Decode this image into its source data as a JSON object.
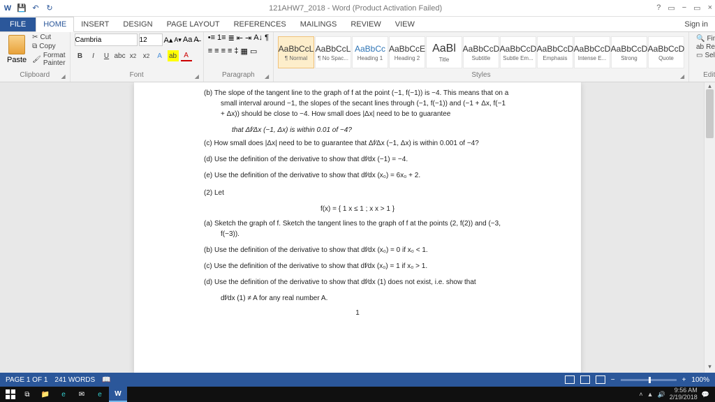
{
  "titlebar": {
    "title": "121AHW7_2018 - Word (Product Activation Failed)",
    "help": "?",
    "restore": "▭",
    "min": "−",
    "close": "×"
  },
  "tabs": {
    "file": "FILE",
    "items": [
      "HOME",
      "INSERT",
      "DESIGN",
      "PAGE LAYOUT",
      "REFERENCES",
      "MAILINGS",
      "REVIEW",
      "VIEW"
    ],
    "signin": "Sign in"
  },
  "clipboard": {
    "label": "Clipboard",
    "paste": "Paste",
    "cut": "Cut",
    "copy": "Copy",
    "fp": "Format Painter"
  },
  "font": {
    "label": "Font",
    "name": "Cambria",
    "size": "12"
  },
  "paragraph": {
    "label": "Paragraph"
  },
  "styles": {
    "label": "Styles",
    "items": [
      {
        "preview": "AaBbCcL",
        "name": "¶ Normal"
      },
      {
        "preview": "AaBbCcL",
        "name": "¶ No Spac..."
      },
      {
        "preview": "AaBbCc",
        "name": "Heading 1"
      },
      {
        "preview": "AaBbCcE",
        "name": "Heading 2"
      },
      {
        "preview": "AaBl",
        "name": "Title"
      },
      {
        "preview": "AaBbCcD",
        "name": "Subtitle"
      },
      {
        "preview": "AaBbCcD",
        "name": "Subtle Em..."
      },
      {
        "preview": "AaBbCcD",
        "name": "Emphasis"
      },
      {
        "preview": "AaBbCcD",
        "name": "Intense E..."
      },
      {
        "preview": "AaBbCcD",
        "name": "Strong"
      },
      {
        "preview": "AaBbCcD",
        "name": "Quote"
      }
    ]
  },
  "editing": {
    "label": "Editing",
    "find": "Find",
    "replace": "Replace",
    "select": "Select"
  },
  "doc": {
    "b": "(b)  The slope of the tangent line to the graph of f at the point (−1, f(−1)) is −4. This means that on a small interval around −1, the slopes of the secant lines through (−1, f(−1)) and (−1 + Δx, f(−1 + Δx)) should be close to −4. How small does |Δx| need to be to guarantee",
    "b2": "that  Δf⁄Δx (−1, Δx)   is within 0.01 of −4?",
    "c": "(c)  How small does |Δx| need to be to guarantee that  Δf⁄Δx (−1, Δx)  is within 0.001 of −4?",
    "d": "(d)  Use the definition of the derivative to show that  df⁄dx (−1) = −4.",
    "e": "(e)  Use the definition of the derivative to show that  df⁄dx (x₀) = 6x₀ + 2.",
    "q2": "(2)  Let",
    "piece": "f(x) = { 1   x ≤ 1 ;   x   x > 1 }",
    "a2": "(a)  Sketch the graph of f. Sketch the tangent lines to the graph of f at the points (2, f(2)) and (−3, f(−3)).",
    "b3": "(b)  Use the definition of the derivative to show that  df⁄dx (x₀) = 0 if x₀ < 1.",
    "c2": "(c)  Use the definition of the derivative to show that  df⁄dx (x₀) = 1 if x₀ > 1.",
    "d2": "(d)  Use the definition of the derivative to show that   df⁄dx (1) does not exist, i.e. show that",
    "d3": "df⁄dx (1) ≠ A for any real number A.",
    "pagenum": "1"
  },
  "status": {
    "page": "PAGE 1 OF 1",
    "words": "241 WORDS",
    "zoom": "100%"
  },
  "tray": {
    "time": "9:56 AM",
    "date": "2/19/2018"
  }
}
